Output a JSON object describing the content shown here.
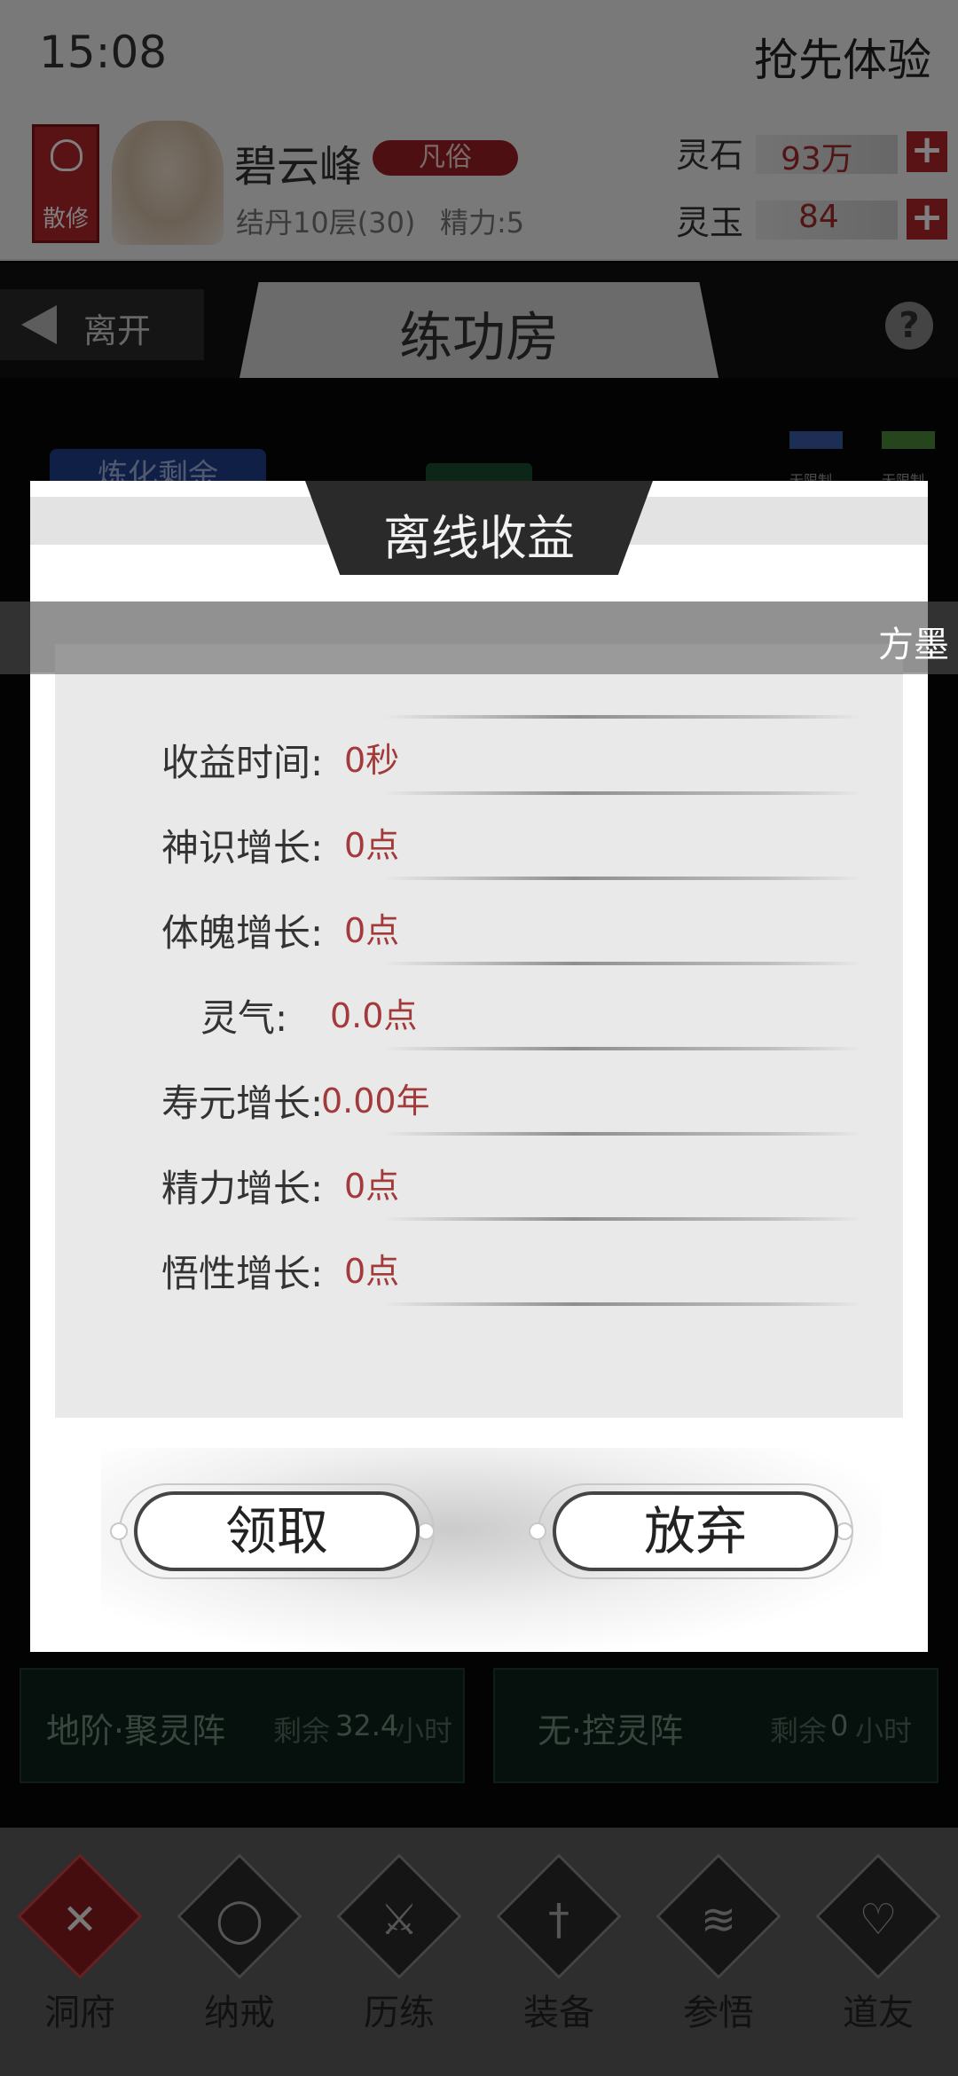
{
  "status": {
    "time": "15:08",
    "early_access": "抢先体验"
  },
  "player": {
    "sect_badge": "散修",
    "name": "碧云峰",
    "realm_tag": "凡俗",
    "cultivation": "结丹10层(30)",
    "energy": "精力:5",
    "resources": [
      {
        "label": "灵石",
        "value": "93万"
      },
      {
        "label": "灵玉",
        "value": "84"
      }
    ],
    "plus_symbol": "+"
  },
  "nav": {
    "leave": "离开",
    "room_title": "练功房",
    "help": "?"
  },
  "arena": {
    "refine_button": "炼化剩余",
    "icon_labels": [
      "无限制",
      "无限制"
    ]
  },
  "modal": {
    "title": "离线收益",
    "rows": [
      {
        "label": "收益时间:",
        "value": "0秒"
      },
      {
        "label": "神识增长:",
        "value": "0点"
      },
      {
        "label": "体魄增长:",
        "value": "0点"
      },
      {
        "label": "灵气:",
        "value": "0.0点"
      },
      {
        "label": "寿元增长:",
        "value": "0.00年"
      },
      {
        "label": "精力增长:",
        "value": "0点"
      },
      {
        "label": "悟性增长:",
        "value": "0点"
      }
    ],
    "claim_button": "领取",
    "abandon_button": "放弃"
  },
  "ticker": {
    "text": "方墨"
  },
  "arrays": [
    {
      "name": "地阶·聚灵阵",
      "remain_prefix": "剩余",
      "remain_value": "32.4",
      "remain_unit": "小时"
    },
    {
      "name": "无·控灵阵",
      "remain_prefix": "剩余",
      "remain_value": "0",
      "remain_unit": "小时"
    }
  ],
  "tabs": [
    {
      "label": "洞府",
      "icon": "close-icon",
      "glyph": "✕",
      "active": true
    },
    {
      "label": "纳戒",
      "icon": "ring-icon",
      "glyph": "◯",
      "active": false
    },
    {
      "label": "历练",
      "icon": "crossed-swords-icon",
      "glyph": "⚔",
      "active": false
    },
    {
      "label": "装备",
      "icon": "dagger-icon",
      "glyph": "†",
      "active": false
    },
    {
      "label": "参悟",
      "icon": "book-icon",
      "glyph": "≋",
      "active": false
    },
    {
      "label": "道友",
      "icon": "handshake-icon",
      "glyph": "♡",
      "active": false
    }
  ],
  "colors": {
    "accent_red": "#b3262b",
    "value_red": "#a33a3a",
    "title_plate": "#2a2a2a"
  }
}
